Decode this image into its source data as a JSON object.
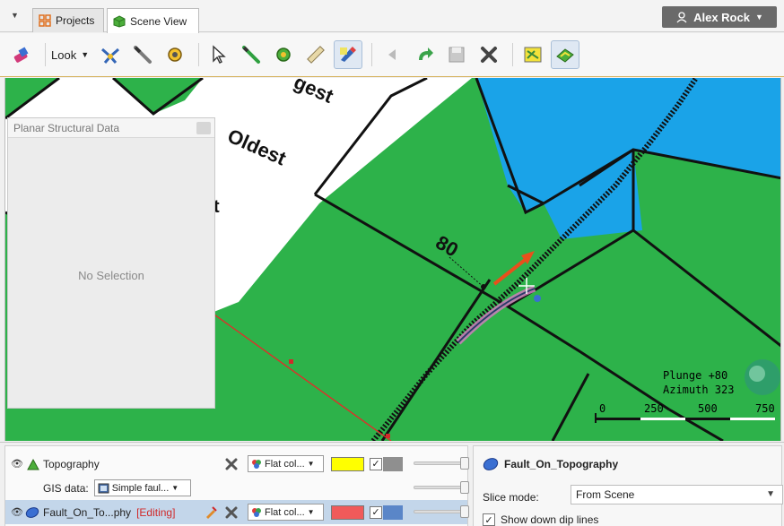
{
  "tabs": {
    "projects": "Projects",
    "scene_view": "Scene View"
  },
  "user": {
    "name": "Alex Rock"
  },
  "toolbar": {
    "look_label": "Look"
  },
  "scene": {
    "unit_labels": [
      "Oldest",
      "gest",
      "t"
    ],
    "dip_label": "80",
    "compass": {
      "plunge": "Plunge +80",
      "azimuth": "Azimuth 323"
    },
    "scale_bar": {
      "ticks": [
        "0",
        "250",
        "500",
        "750"
      ]
    },
    "colors": {
      "unit_green": "#2db24a",
      "unit_blue": "#1aa3e8",
      "unit_white": "#ffffff",
      "arrow": "#e8501c"
    }
  },
  "structural_panel": {
    "title": "Planar Structural Data",
    "empty_text": "No Selection"
  },
  "layers": {
    "topography": {
      "name": "Topography",
      "style": "Flat col...",
      "color": "#ffff00"
    },
    "gis": {
      "label": "GIS data:",
      "value": "Simple faul..."
    },
    "fault": {
      "name": "Fault_On_To...phy",
      "status": "[Editing]",
      "style": "Flat col...",
      "color": "#f05a5a"
    }
  },
  "properties": {
    "title": "Fault_On_Topography",
    "slice_mode_label": "Slice mode:",
    "slice_mode_value": "From Scene",
    "show_dip_lines_label": "Show down dip lines"
  }
}
